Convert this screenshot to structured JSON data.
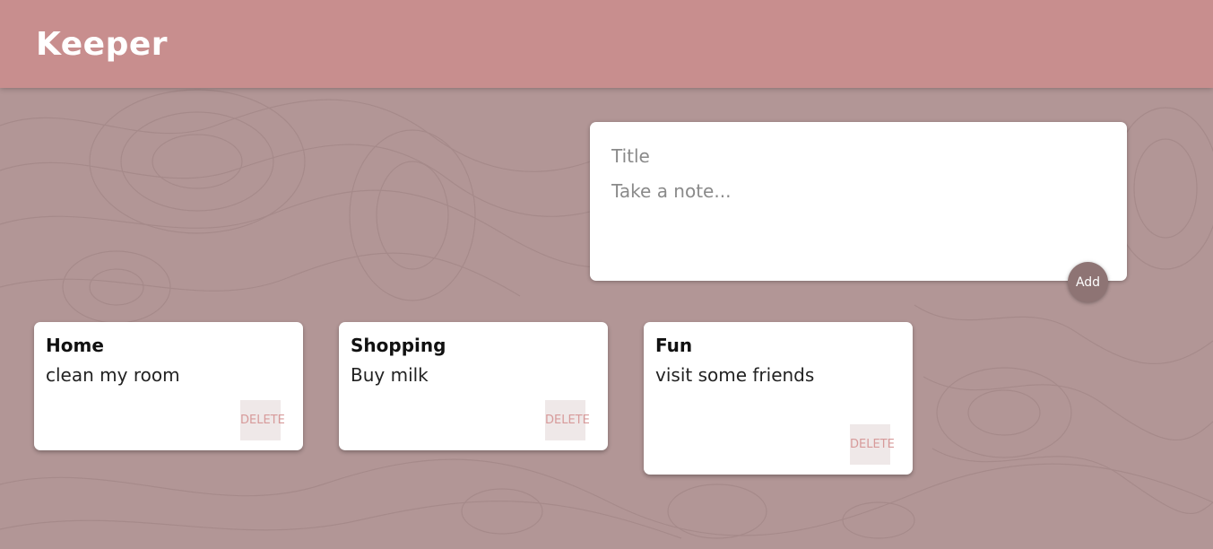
{
  "app": {
    "title": "Keeper"
  },
  "create_note": {
    "title_placeholder": "Title",
    "content_placeholder": "Take a note...",
    "add_label": "Add"
  },
  "notes": [
    {
      "title": "Home",
      "content": "clean my room",
      "delete_label": "DELETE"
    },
    {
      "title": "Shopping",
      "content": "Buy milk",
      "delete_label": "DELETE"
    },
    {
      "title": "Fun",
      "content": "visit some friends",
      "delete_label": "DELETE"
    }
  ],
  "colors": {
    "header": "#cd8c8c",
    "background": "#b29696",
    "add_button": "#8e7474",
    "delete_text": "#d79a9a"
  }
}
